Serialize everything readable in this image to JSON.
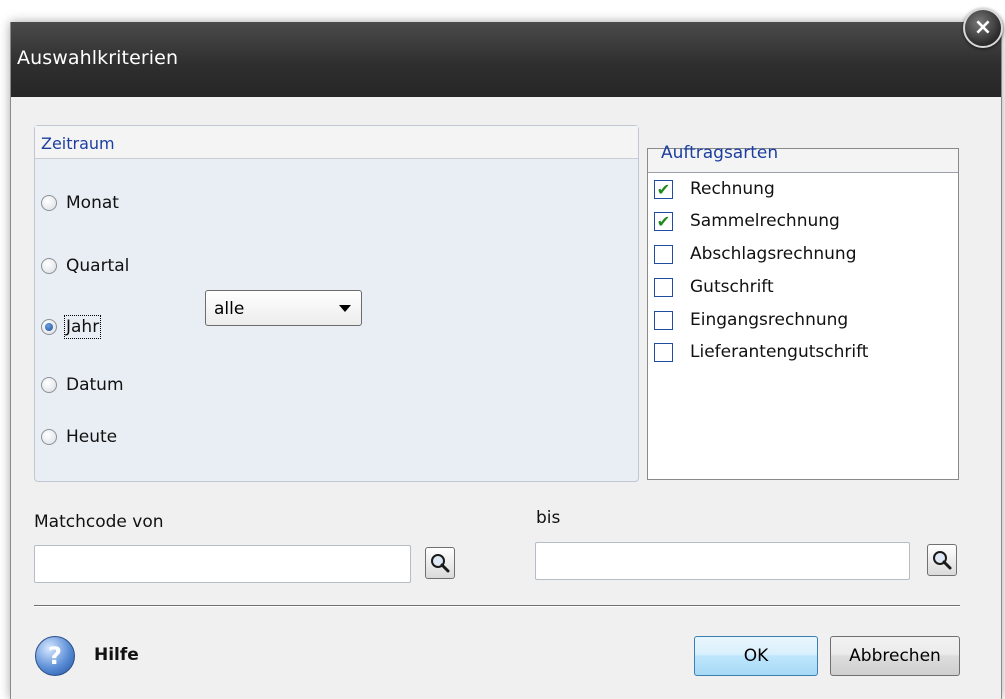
{
  "dialog": {
    "title": "Auswahlkriterien",
    "close_symbol": "×"
  },
  "zeitraum": {
    "title": "Zeitraum",
    "options": [
      {
        "label": "Monat",
        "checked": false
      },
      {
        "label": "Quartal",
        "checked": false
      },
      {
        "label": "Jahr",
        "checked": true
      },
      {
        "label": "Datum",
        "checked": false
      },
      {
        "label": "Heute",
        "checked": false
      }
    ],
    "year_select": {
      "value": "alle"
    }
  },
  "auftragsarten": {
    "title": "Auftragsarten",
    "items": [
      {
        "label": "Rechnung",
        "checked": true
      },
      {
        "label": "Sammelrechnung",
        "checked": true
      },
      {
        "label": "Abschlagsrechnung",
        "checked": false
      },
      {
        "label": "Gutschrift",
        "checked": false
      },
      {
        "label": "Eingangsrechnung",
        "checked": false
      },
      {
        "label": "Lieferantengutschrift",
        "checked": false
      }
    ]
  },
  "matchcode": {
    "from_label": "Matchcode von",
    "from_value": "",
    "to_label": "bis",
    "to_value": ""
  },
  "footer": {
    "help_label": "Hilfe",
    "help_symbol": "?",
    "ok_label": "OK",
    "cancel_label": "Abbrechen"
  },
  "icons": {
    "close": "close-icon",
    "help": "help-icon",
    "search": "magnifier-icon",
    "dropdown": "chevron-down-icon",
    "check": "checkmark-icon"
  },
  "colors": {
    "titlebar": "#2f2f2f",
    "group_title": "#1c3f9f",
    "checkmark": "#1f8a1f",
    "ok_button": "#bee6fd"
  }
}
